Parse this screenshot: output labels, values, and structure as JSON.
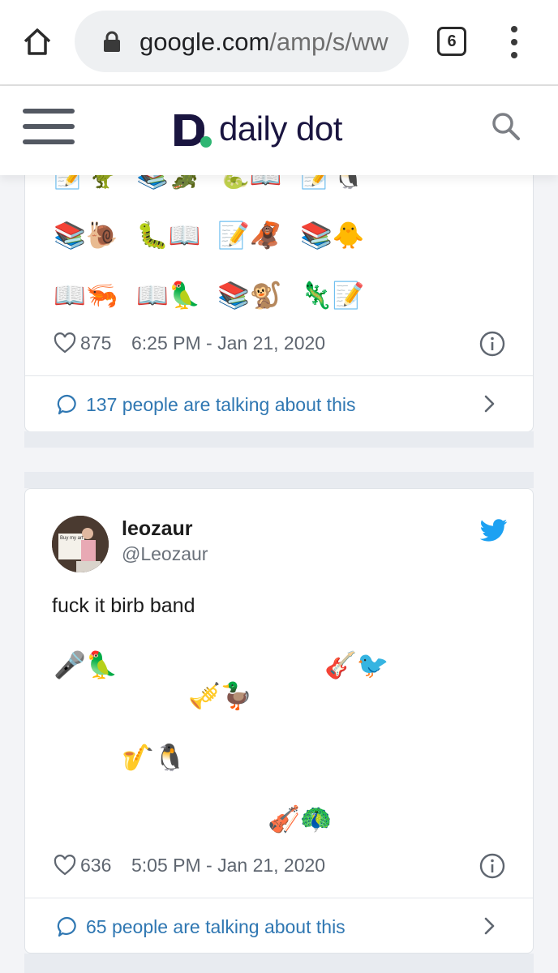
{
  "browser": {
    "url_domain": "google.com",
    "url_path": "/amp/s/ww",
    "tab_count": "6"
  },
  "site": {
    "logo_text": "daily dot",
    "brand_color": "#1a1540",
    "logo_dot_color": "#2fb673"
  },
  "tweets": [
    {
      "emoji_rows": [
        [
          "📝🦖",
          "📚🐊",
          "🐍📖",
          "📝🐧"
        ],
        [
          "📚🐌",
          "🐛📖",
          "📝🦧",
          "📚🐥"
        ],
        [
          "📖🦐",
          "📖🦜",
          "📚🐒",
          "🦎📝"
        ]
      ],
      "likes": "875",
      "timestamp": "6:25 PM - Jan 21, 2020",
      "talking": "137 people are talking about this"
    },
    {
      "name": "leozaur",
      "handle": "@Leozaur",
      "text": "fuck it birb band",
      "avatar_sign": "Buy my art",
      "emoji": [
        "🎤🦜",
        "🎸🐦",
        "🎺🦆",
        "🎷🐧",
        "🎻🦚"
      ],
      "likes": "636",
      "timestamp": "5:05 PM - Jan 21, 2020",
      "talking": "65 people are talking about this"
    }
  ],
  "colors": {
    "link": "#2f77b2",
    "twitter": "#1da1f2",
    "muted": "#5f6670"
  }
}
